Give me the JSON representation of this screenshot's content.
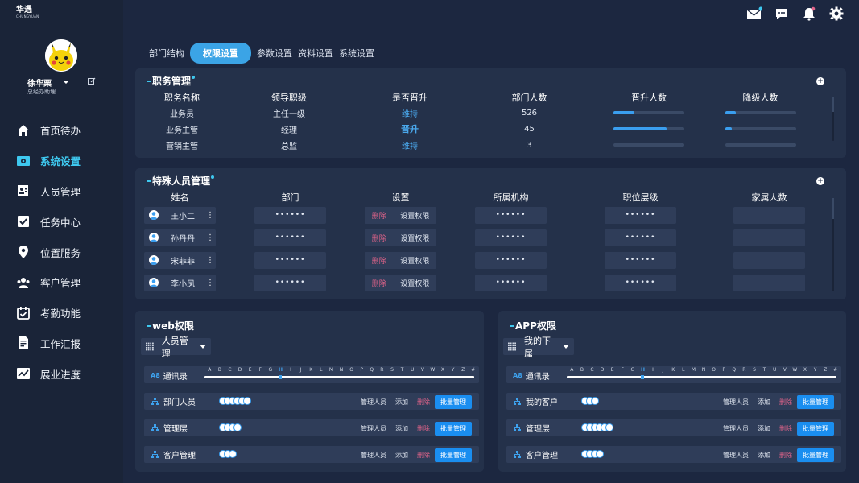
{
  "brand": {
    "name": "华遇",
    "sub": "CHUNGYUAN"
  },
  "user": {
    "name": "徐华栗",
    "role": "总经办助理"
  },
  "nav": [
    {
      "label": "首页待办",
      "icon": "home-icon"
    },
    {
      "label": "系统设置",
      "icon": "settings-icon"
    },
    {
      "label": "人员管理",
      "icon": "personnel-icon"
    },
    {
      "label": "任务中心",
      "icon": "task-check-icon"
    },
    {
      "label": "位置服务",
      "icon": "location-pin-icon"
    },
    {
      "label": "客户管理",
      "icon": "customers-icon"
    },
    {
      "label": "考勤功能",
      "icon": "attendance-calendar-icon"
    },
    {
      "label": "工作汇报",
      "icon": "report-doc-icon"
    },
    {
      "label": "展业进度",
      "icon": "progress-chart-icon"
    }
  ],
  "active_nav_index": 1,
  "topbar_icons": [
    "mail-icon",
    "chat-icon",
    "bell-icon",
    "gear-icon"
  ],
  "tabs": [
    "部门结构",
    "权限设置",
    "参数设置",
    "资料设置",
    "系统设置"
  ],
  "active_tab_index": 1,
  "job_panel": {
    "title": "职务管理",
    "headers": [
      "职务名称",
      "领导职级",
      "是否晋升",
      "部门人数",
      "晋升人数",
      "降级人数"
    ],
    "rows": [
      {
        "name": "业务员",
        "level": "主任一级",
        "promote": "维持",
        "count": "526",
        "promo_fill": 0.3,
        "demote_fill": 0.15
      },
      {
        "name": "业务主管",
        "level": "经理",
        "promote": "晋升",
        "count": "45",
        "promo_fill": 0.75,
        "demote_fill": 0.1
      },
      {
        "name": "营销主管",
        "level": "总监",
        "promote": "维持",
        "count": "3",
        "promo_fill": 0,
        "demote_fill": 0
      }
    ]
  },
  "special_panel": {
    "title": "特殊人员管理",
    "headers": [
      "姓名",
      "部门",
      "设置",
      "所属机构",
      "职位层级",
      "家属人数"
    ],
    "delete_label": "删除",
    "setperm_label": "设置权限",
    "rows": [
      {
        "name": "王小二",
        "dept": "••••••",
        "org": "••••••",
        "level": "••••••",
        "family": ""
      },
      {
        "name": "孙丹丹",
        "dept": "••••••",
        "org": "••••••",
        "level": "••••••",
        "family": ""
      },
      {
        "name": "宋菲菲",
        "dept": "••••••",
        "org": "••••••",
        "level": "••••••",
        "family": ""
      },
      {
        "name": "李小凤",
        "dept": "••••••",
        "org": "••••••",
        "level": "••••••",
        "family": ""
      }
    ]
  },
  "alphabet": [
    "A",
    "B",
    "C",
    "D",
    "E",
    "F",
    "G",
    "H",
    "I",
    "J",
    "K",
    "L",
    "M",
    "N",
    "O",
    "P",
    "Q",
    "R",
    "S",
    "T",
    "U",
    "V",
    "W",
    "X",
    "Y",
    "Z",
    "#"
  ],
  "active_letter": "H",
  "web_panel": {
    "title": "web权限",
    "select": "人员管理",
    "contacts_label": "通讯录",
    "rows": [
      {
        "label": "部门人员",
        "avatars": 6
      },
      {
        "label": "管理层",
        "avatars": 4
      },
      {
        "label": "客户管理",
        "avatars": 3
      }
    ]
  },
  "app_panel": {
    "title": "APP权限",
    "select": "我的下属",
    "contacts_label": "通讯录",
    "rows": [
      {
        "label": "我的客户",
        "avatars": 3
      },
      {
        "label": "管理层",
        "avatars": 6
      },
      {
        "label": "客户管理",
        "avatars": 4
      }
    ]
  },
  "perm_actions": {
    "manage": "管理人员",
    "add": "添加",
    "delete": "删除",
    "batch": "批量管理"
  },
  "colors": {
    "accent": "#3ec8ef",
    "primary": "#3ba4e6",
    "danger": "#e2648a",
    "bg": "#1c2740",
    "panel": "#24314a"
  }
}
